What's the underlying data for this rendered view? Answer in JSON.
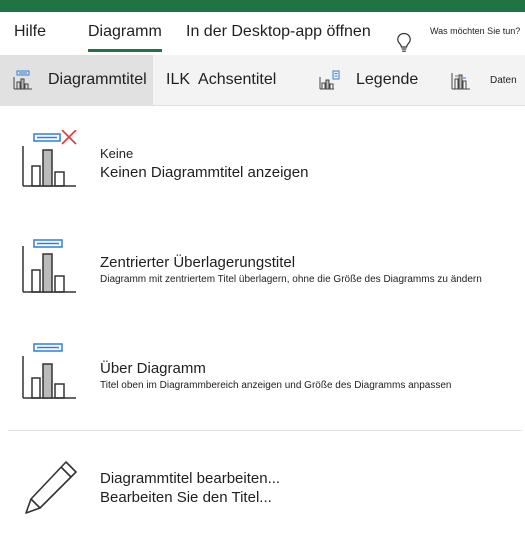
{
  "tabs": [
    {
      "label": "Hilfe",
      "active": false
    },
    {
      "label": "Diagramm",
      "active": true
    },
    {
      "label": "In der Desktop-app öffnen",
      "active": false
    }
  ],
  "tell_me": {
    "placeholder": "Was möchten Sie tun?"
  },
  "ribbon": {
    "chart_title": "Diagrammtitel",
    "axis_title_prefix": "ILK",
    "axis_title": "Achsentitel",
    "legend": "Legende",
    "data": "Daten"
  },
  "menu": {
    "none": {
      "title": "Keine",
      "description": "Keinen Diagrammtitel anzeigen"
    },
    "centered": {
      "title": "Zentrierter Überlagerungstitel",
      "description": "Diagramm mit zentriertem Titel überlagern, ohne die Größe des Diagramms zu ändern"
    },
    "above": {
      "title": "Über Diagramm",
      "description": "Titel oben im Diagrammbereich anzeigen und Größe des Diagramms anpassen"
    },
    "edit": {
      "title": "Diagrammtitel bearbeiten...",
      "description": "Bearbeiten Sie den Titel..."
    }
  },
  "colors": {
    "accent": "#217346",
    "icon_blue": "#2f7ed8",
    "icon_red": "#e03a3a"
  }
}
